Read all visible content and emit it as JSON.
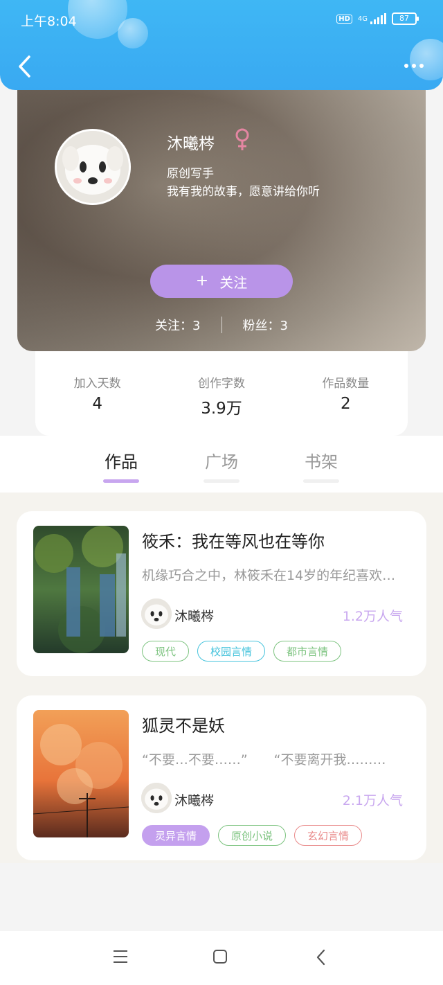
{
  "status_bar": {
    "time": "上午8:04",
    "hd": "HD",
    "network": "4G",
    "battery": "87"
  },
  "profile": {
    "name": "沐曦梣",
    "role": "原创写手",
    "bio": "我有我的故事，愿意讲给你听",
    "follow_plus": "+",
    "follow_label": "关注",
    "following": "关注：3",
    "fans": "粉丝：3"
  },
  "stats": [
    {
      "label": "加入天数",
      "value": "4"
    },
    {
      "label": "创作字数",
      "value": "3.9万"
    },
    {
      "label": "作品数量",
      "value": "2"
    }
  ],
  "tabs": [
    {
      "label": "作品",
      "active": true
    },
    {
      "label": "广场",
      "active": false
    },
    {
      "label": "书架",
      "active": false
    }
  ],
  "books": [
    {
      "title": "筱禾：我在等风也在等你",
      "description": "机缘巧合之中，林筱禾在14岁的年纪喜欢…",
      "author": "沐曦梣",
      "popularity": "1.2万人气",
      "tags": [
        {
          "label": "现代",
          "color": "#7cc37f",
          "style": "outline"
        },
        {
          "label": "校园言情",
          "color": "#45c3dc",
          "style": "outline"
        },
        {
          "label": "都市言情",
          "color": "#7cc37f",
          "style": "outline"
        }
      ]
    },
    {
      "title": "狐灵不是妖",
      "description": "“不要…不要……”　　“不要离开我………",
      "author": "沐曦梣",
      "popularity": "2.1万人气",
      "tags": [
        {
          "label": "灵异言情",
          "color": "#c4a0ee",
          "style": "filled"
        },
        {
          "label": "原创小说",
          "color": "#7cc37f",
          "style": "outline"
        },
        {
          "label": "玄幻言情",
          "color": "#e98a8a",
          "style": "outline"
        }
      ]
    }
  ],
  "icons": {
    "back": "chevron-left-icon",
    "more": "more-dots-icon",
    "gender": "female-icon",
    "nav_menu": "menu-icon",
    "nav_home": "home-icon",
    "nav_back": "back-icon"
  },
  "colors": {
    "header": "#3fb7f4",
    "accent": "#b994e8",
    "tab_underline": "#c8a6ef",
    "popularity": "#c9a8ef"
  }
}
